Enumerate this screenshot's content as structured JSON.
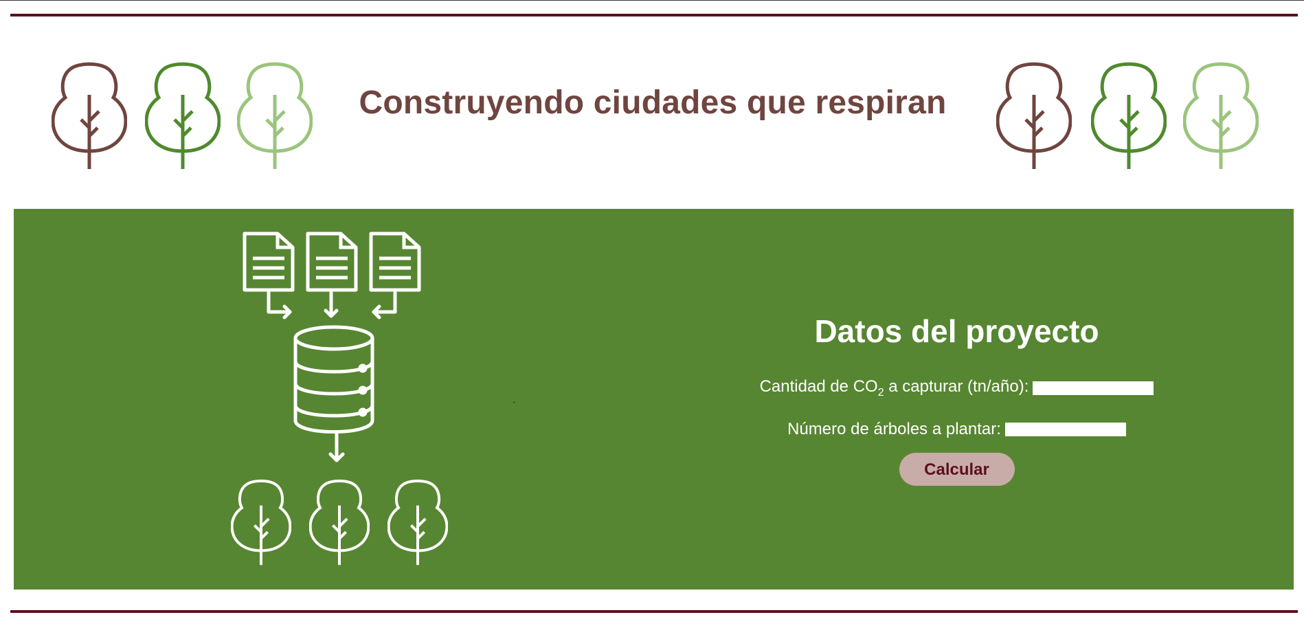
{
  "header": {
    "title": "Construyendo ciudades que respiran"
  },
  "colors": {
    "rule": "#5a1020",
    "title": "#6f4540",
    "panel": "#578632",
    "tree_brown": "#6f4540",
    "tree_green": "#4f8a2e",
    "tree_light": "#9bc47d",
    "button_bg": "#c8aca8",
    "button_text": "#5a1020"
  },
  "form": {
    "heading": "Datos del proyecto",
    "co2_label_prefix": "Cantidad de CO",
    "co2_label_sub": "2",
    "co2_label_suffix": " a capturar (tn/año):",
    "co2_value": "",
    "trees_label": "Número de árboles a plantar:",
    "trees_value": "",
    "calculate_label": "Calcular"
  },
  "icons": {
    "header_trees_left": [
      "tree-icon",
      "tree-icon",
      "tree-icon"
    ],
    "header_trees_right": [
      "tree-icon",
      "tree-icon",
      "tree-icon"
    ],
    "illustration": [
      "document-icon",
      "database-icon",
      "arrow-down-icon",
      "tree-icon"
    ]
  }
}
